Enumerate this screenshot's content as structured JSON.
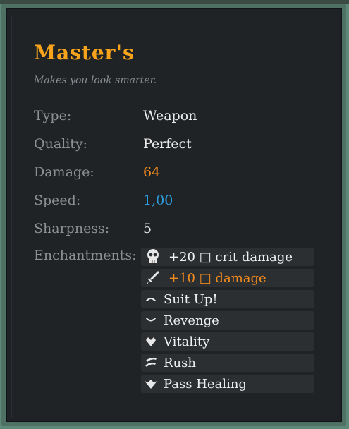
{
  "item": {
    "title": "Master's",
    "description": "Makes you look smarter."
  },
  "stats": [
    {
      "label": "Type:",
      "value": "Weapon",
      "color": "#eaeaea"
    },
    {
      "label": "Quality:",
      "value": "Perfect",
      "color": "#eaeaea"
    },
    {
      "label": "Damage:",
      "value": "64",
      "color": "#f28a1d"
    },
    {
      "label": "Speed:",
      "value": "1,00",
      "color": "#2e9fe0"
    },
    {
      "label": "Sharpness:",
      "value": "5",
      "color": "#eaeaea"
    }
  ],
  "enchantments_label": "Enchantments:",
  "enchantments": [
    {
      "text": "+20 □ crit damage",
      "icon": "skull-icon",
      "color": "#f0f0f0"
    },
    {
      "text": "+10 □ damage",
      "icon": "sword-icon",
      "color": "#f28a1d"
    },
    {
      "text": "Suit Up!",
      "icon": "suit-up-icon",
      "color": "#f0f0f0"
    },
    {
      "text": "Revenge",
      "icon": "revenge-icon",
      "color": "#f0f0f0"
    },
    {
      "text": "Vitality",
      "icon": "vitality-icon",
      "color": "#f0f0f0"
    },
    {
      "text": "Rush",
      "icon": "rush-icon",
      "color": "#f0f0f0"
    },
    {
      "text": "Pass Healing",
      "icon": "pass-healing-icon",
      "color": "#f0f0f0"
    }
  ]
}
